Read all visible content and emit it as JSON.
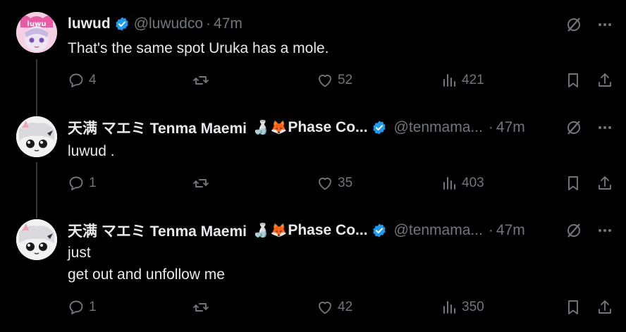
{
  "tweets": [
    {
      "name": "luwud",
      "handle": "@luwudco",
      "time": "47m",
      "text_lines": [
        "That's the same spot Uruka has a mole."
      ],
      "replies": "4",
      "likes": "52",
      "views": "421",
      "avatar": "pink-anime-avatar"
    },
    {
      "name": "天满 マエミ Tenma Maemi",
      "name_suffix": "Phase Co...",
      "emojis": [
        "🍶",
        "🦊"
      ],
      "handle": "@tenmama...",
      "time": "47m",
      "text_lines": [
        "luwud ."
      ],
      "replies": "1",
      "likes": "35",
      "views": "403",
      "avatar": "white-fox-avatar"
    },
    {
      "name": "天满 マエミ Tenma Maemi",
      "name_suffix": "Phase Co...",
      "emojis": [
        "🍶",
        "🦊"
      ],
      "handle": "@tenmama...",
      "time": "47m",
      "text_lines": [
        "just",
        "get out and unfollow me"
      ],
      "replies": "1",
      "likes": "42",
      "views": "350",
      "avatar": "white-fox-avatar"
    }
  ],
  "separator": "·",
  "colors": {
    "background": "#000000",
    "text": "#e7e9ea",
    "muted": "#71767b",
    "verified": "#1d9bf0",
    "line": "#333639"
  }
}
